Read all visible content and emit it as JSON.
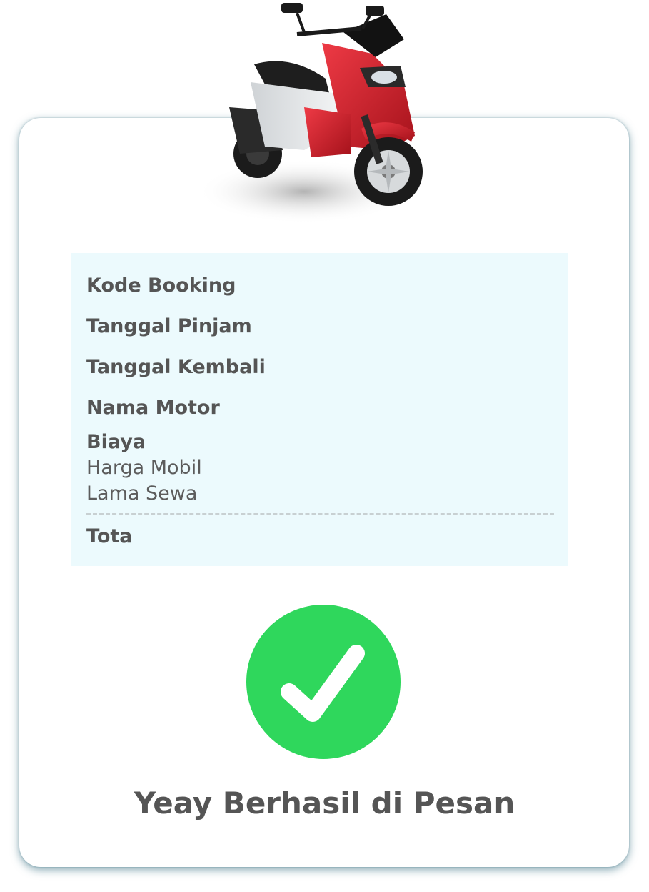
{
  "booking": {
    "code_label": "Kode Booking",
    "pickup_date_label": "Tanggal Pinjam",
    "return_date_label": "Tanggal Kembali",
    "motor_name_label": "Nama Motor",
    "cost_label": "Biaya",
    "price_label": "Harga Mobil",
    "duration_label": "Lama Sewa",
    "total_label": "Tota"
  },
  "status": {
    "message": "Yeay Berhasil di Pesan",
    "icon": "check-circle-icon",
    "color": "#2fd75c"
  },
  "image": {
    "subject": "red-scooter-image",
    "color": "#d3202c"
  }
}
